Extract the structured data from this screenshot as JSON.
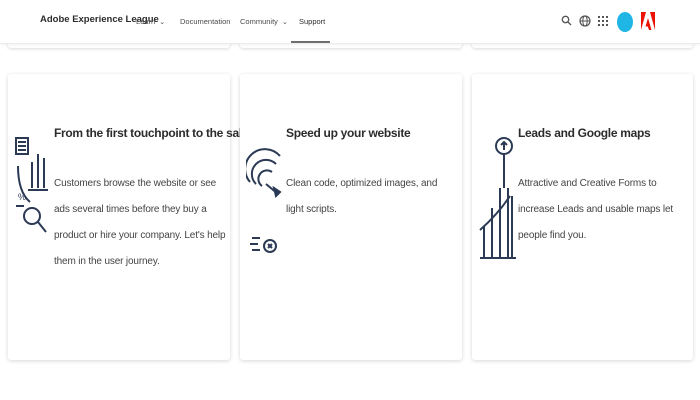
{
  "header": {
    "brand": "Adobe Experience League",
    "nav": {
      "learn": "Learn",
      "documentation": "Documentation",
      "community": "Community",
      "support": "Support"
    },
    "icons": {
      "search": "search-icon",
      "globe": "globe-icon",
      "apps": "apps-grid-icon",
      "avatar": "user-avatar",
      "logo": "adobe-logo"
    }
  },
  "cards": [
    {
      "title": "From the first touchpoint to the sale",
      "description": "Customers browse the website or see ads several times before they buy a product or hire your company. Let's help them in the user journey.",
      "icon": "analytics-icon"
    },
    {
      "title": "Speed up your website",
      "description": "Clean code, optimized images, and light scripts.",
      "icon": "speedometer-icon"
    },
    {
      "title": "Leads and Google maps",
      "description": "Attractive and Creative Forms to increase Leads and usable maps let people find you.",
      "icon": "growth-chart-icon"
    }
  ],
  "colors": {
    "icon_navy": "#2b3a55",
    "avatar": "#1fb6e6",
    "adobe_red": "#eb1000"
  }
}
